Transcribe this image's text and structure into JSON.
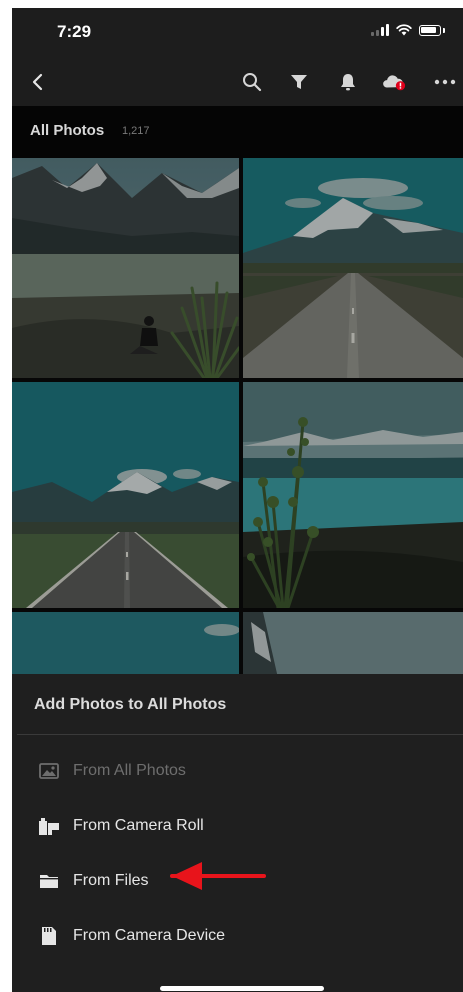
{
  "status_bar": {
    "time": "7:29",
    "icons": [
      "signal-icon",
      "wifi-icon",
      "battery-icon"
    ]
  },
  "nav_bar": {
    "icons": [
      "back-chevron-icon",
      "search-icon",
      "filter-icon",
      "bell-icon",
      "cloud-sync-icon",
      "more-icon"
    ],
    "badge_color": "#e0001b"
  },
  "section": {
    "title": "All Photos",
    "count": "1,217"
  },
  "photos": [
    {
      "subject": "mountain-lake-person"
    },
    {
      "subject": "road-snowy-peak"
    },
    {
      "subject": "road-valley-mountains"
    },
    {
      "subject": "lake-shrub-shore"
    },
    {
      "subject": "sky-partial"
    },
    {
      "subject": "mountain-partial"
    }
  ],
  "sheet": {
    "title": "Add Photos to All Photos",
    "items": [
      {
        "label": "From All Photos",
        "icon": "photo-library-icon",
        "enabled": false
      },
      {
        "label": "From Camera Roll",
        "icon": "camera-roll-icon",
        "enabled": true
      },
      {
        "label": "From Files",
        "icon": "folder-icon",
        "enabled": true
      },
      {
        "label": "From Camera Device",
        "icon": "sd-card-icon",
        "enabled": true
      }
    ]
  },
  "colors": {
    "background": "#1d1d1d",
    "sheet": "#1f1f1f",
    "accent_arrow": "#e8141b",
    "text_primary": "#e6e6e6",
    "text_disabled": "#6e6e6e"
  }
}
